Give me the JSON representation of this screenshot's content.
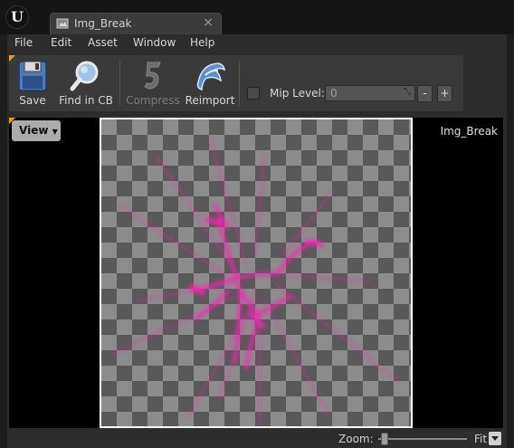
{
  "window": {
    "logo_text": "U",
    "tab_label": "Img_Break"
  },
  "menu": [
    "File",
    "Edit",
    "Asset",
    "Window",
    "Help"
  ],
  "toolbar": {
    "save_label": "Save",
    "find_label": "Find in CB",
    "compress_label": "Compress",
    "reimport_label": "Reimport",
    "mip_label": "Mip Level:",
    "mip_value": "0",
    "mip_minus": "-",
    "mip_plus": "+"
  },
  "viewport": {
    "view_label": "View",
    "asset_name": "Img_Break"
  },
  "status": {
    "zoom_label": "Zoom:",
    "zoom_mode": "Fit"
  },
  "colors": {
    "accent": "#e0a21a",
    "crack": "#ff1fb4"
  }
}
